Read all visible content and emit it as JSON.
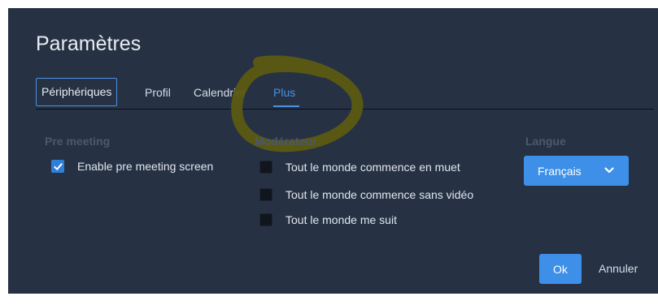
{
  "dialog": {
    "title": "Paramètres",
    "tabs": [
      {
        "label": "Périphériques"
      },
      {
        "label": "Profil"
      },
      {
        "label": "Calendrier"
      },
      {
        "label": "Plus"
      }
    ],
    "sections": {
      "pre_meeting": {
        "label": "Pre meeting",
        "options": [
          {
            "label": "Enable pre meeting screen",
            "checked": true
          }
        ]
      },
      "moderator": {
        "label": "Modérateur",
        "options": [
          {
            "label": "Tout le monde commence en muet",
            "checked": false
          },
          {
            "label": "Tout le monde commence sans vidéo",
            "checked": false
          },
          {
            "label": "Tout le monde me suit",
            "checked": false
          }
        ]
      },
      "language": {
        "label": "Langue",
        "selected": "Français"
      }
    },
    "buttons": {
      "ok": "Ok",
      "cancel": "Annuler"
    }
  },
  "colors": {
    "background": "#263244",
    "accent": "#3d8fe8",
    "annotation": "#5b5a12"
  },
  "icons": {
    "check": "check-icon",
    "dropdown": "chevron-down-icon"
  }
}
